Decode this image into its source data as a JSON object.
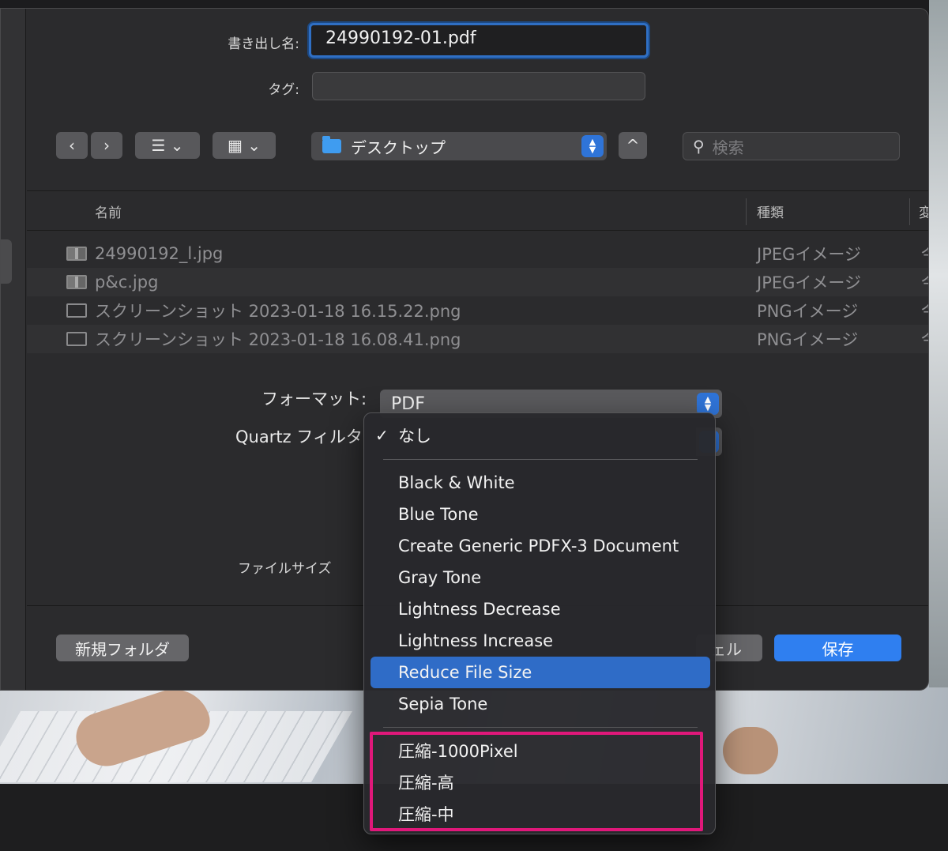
{
  "dialog": {
    "save_as_label": "書き出し名:",
    "save_as_value": "24990192-01.pdf",
    "tags_label": "タグ:",
    "tags_value": "",
    "location": "デスクトップ",
    "search_placeholder": "検索"
  },
  "toolbar": {
    "back": "‹",
    "forward": "›",
    "list_view": "☰ ⌄",
    "icon_view": "▦ ⌄",
    "expand": "^"
  },
  "columns": {
    "name": "名前",
    "kind": "種類",
    "date": "変"
  },
  "files": [
    {
      "name": "24990192_l.jpg",
      "kind": "JPEGイメージ",
      "date": "今"
    },
    {
      "name": "p&c.jpg",
      "kind": "JPEGイメージ",
      "date": "今"
    },
    {
      "name": "スクリーンショット 2023-01-18 16.15.22.png",
      "kind": "PNGイメージ",
      "date": "今"
    },
    {
      "name": "スクリーンショット 2023-01-18 16.08.41.png",
      "kind": "PNGイメージ",
      "date": "今"
    }
  ],
  "options": {
    "format_label": "フォーマット:",
    "format_value": "PDF",
    "quartz_label": "Quartz フィルタ",
    "filesize_label": "ファイルサイズ"
  },
  "buttons": {
    "new_folder": "新規フォルダ",
    "cancel": "ェル",
    "save": "保存"
  },
  "menu": {
    "none": "なし",
    "items": [
      "Black & White",
      "Blue Tone",
      "Create Generic PDFX-3 Document",
      "Gray Tone",
      "Lightness Decrease",
      "Lightness Increase",
      "Reduce File Size",
      "Sepia Tone"
    ],
    "custom": [
      "圧縮-1000Pixel",
      "圧縮-高",
      "圧縮-中"
    ]
  },
  "colors": {
    "accent": "#2f7ff0",
    "selection": "#2f6cc7",
    "annotation": "#e0187a"
  }
}
